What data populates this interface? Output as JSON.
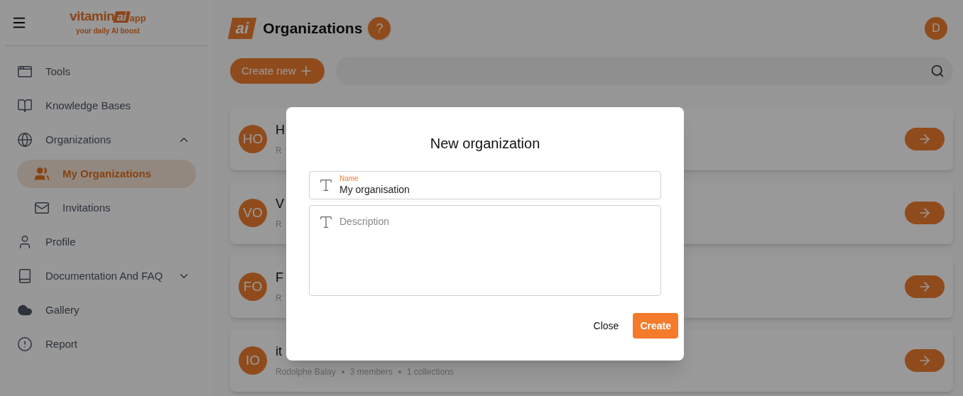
{
  "logo": {
    "name": "vitamin",
    "mark": "ai",
    "suffix": "app",
    "tagline": "your daily AI boost"
  },
  "sidebar": {
    "items": [
      {
        "label": "Tools",
        "selected": false
      },
      {
        "label": "Knowledge Bases",
        "selected": false
      },
      {
        "label": "Organizations",
        "selected": false,
        "expanded": true,
        "children": [
          {
            "label": "My Organizations",
            "selected": true
          },
          {
            "label": "Invitations",
            "selected": false
          }
        ]
      },
      {
        "label": "Profile",
        "selected": false
      },
      {
        "label": "Documentation And FAQ",
        "selected": false,
        "expanded": false
      },
      {
        "label": "Gallery",
        "selected": false
      },
      {
        "label": "Report",
        "selected": false
      }
    ]
  },
  "header": {
    "mark": "ai",
    "title": "Organizations",
    "help": "?",
    "avatar": "D"
  },
  "toolbar": {
    "create_button": "Create new"
  },
  "organizations": [
    {
      "initials": "HO",
      "name": "H",
      "meta": [
        "R"
      ]
    },
    {
      "initials": "VO",
      "name": "V",
      "meta": [
        "R"
      ]
    },
    {
      "initials": "FO",
      "name": "F",
      "meta": [
        "R"
      ]
    },
    {
      "initials": "IO",
      "name": "it",
      "meta": [
        "Rodolphe Balay",
        "3 members",
        "1 collections"
      ]
    }
  ],
  "dialog": {
    "title": "New organization",
    "name_field": {
      "label": "Name",
      "value": "My organisation"
    },
    "description_field": {
      "placeholder": "Description"
    },
    "buttons": {
      "close": "Close",
      "create": "Create"
    }
  }
}
